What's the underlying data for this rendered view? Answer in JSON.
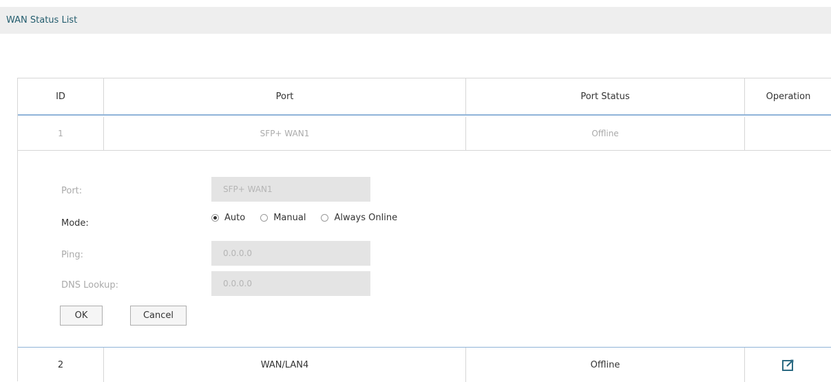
{
  "section": {
    "title": "WAN Status List"
  },
  "table": {
    "headers": [
      "ID",
      "Port",
      "Port Status",
      "Operation"
    ],
    "rows": [
      {
        "id": "1",
        "port": "SFP+ WAN1",
        "status": "Offline"
      },
      {
        "id": "2",
        "port": "WAN/LAN4",
        "status": "Offline",
        "operation_icon": "edit-icon"
      }
    ]
  },
  "form": {
    "port_label": "Port:",
    "port_value": "SFP+ WAN1",
    "mode_label": "Mode:",
    "mode_options": [
      "Auto",
      "Manual",
      "Always Online"
    ],
    "mode_selected": "Auto",
    "ping_label": "Ping:",
    "ping_value": "0.0.0.0",
    "dns_label": "DNS Lookup:",
    "dns_value": "0.0.0.0",
    "ok_label": "OK",
    "cancel_label": "Cancel"
  },
  "colors": {
    "accent": "#245d6e",
    "table_border_highlight": "#8fb3d8",
    "edit_icon": "#2b6a82"
  }
}
